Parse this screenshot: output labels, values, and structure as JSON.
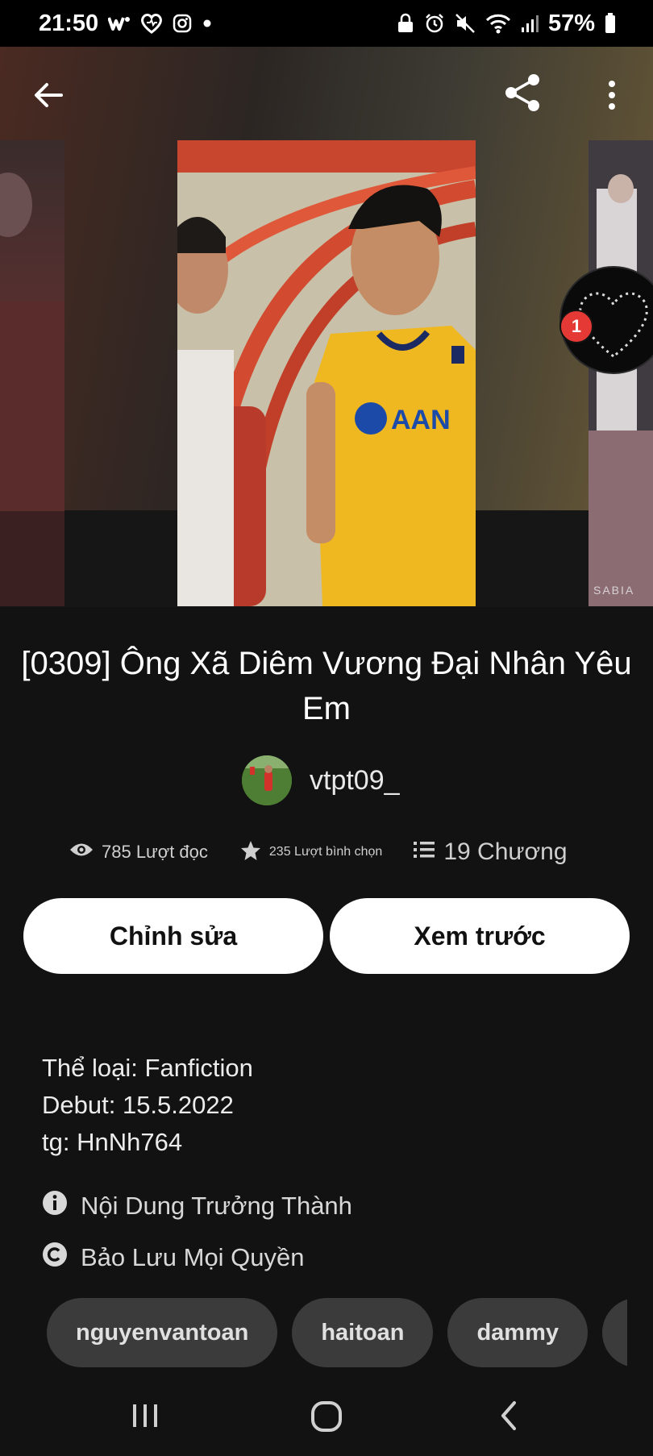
{
  "status_bar": {
    "time": "21:50",
    "battery": "57%",
    "icons": [
      "wattpad-icon",
      "heart-app-icon",
      "instagram-icon",
      "dot-icon",
      "lock-icon",
      "alarm-icon",
      "mute-icon",
      "wifi-icon",
      "signal-icon",
      "battery-icon"
    ]
  },
  "header": {
    "icons": [
      "back-arrow-icon",
      "share-icon",
      "more-vertical-icon"
    ]
  },
  "cover": {
    "jersey_text": "AAN",
    "side_watermark": "SABIA",
    "notification_count": "1"
  },
  "story": {
    "title": "[0309] Ông Xã Diêm Vương Đại Nhân Yêu Em",
    "author": "vtpt09_"
  },
  "stats": {
    "reads": "785 Lượt đọc",
    "votes": "235 Lượt bình chọn",
    "chapters": "19 Chương"
  },
  "buttons": {
    "edit": "Chỉnh sửa",
    "preview": "Xem trước"
  },
  "description": {
    "line1": "Thể loại: Fanfiction",
    "line2": "Debut: 15.5.2022",
    "line3": "tg: HnNh764"
  },
  "info": {
    "mature": "Nội Dung Trưởng Thành",
    "rights": "Bảo Lưu Mọi Quyền"
  },
  "tags": [
    "nguyenvantoan",
    "haitoan",
    "dammy",
    ""
  ],
  "nav": {
    "icons": [
      "recent-apps-icon",
      "home-icon",
      "back-icon"
    ]
  },
  "colors": {
    "background": "#121212",
    "button_bg": "#ffffff",
    "tag_bg": "#3b3b3b",
    "badge": "#e53935"
  }
}
